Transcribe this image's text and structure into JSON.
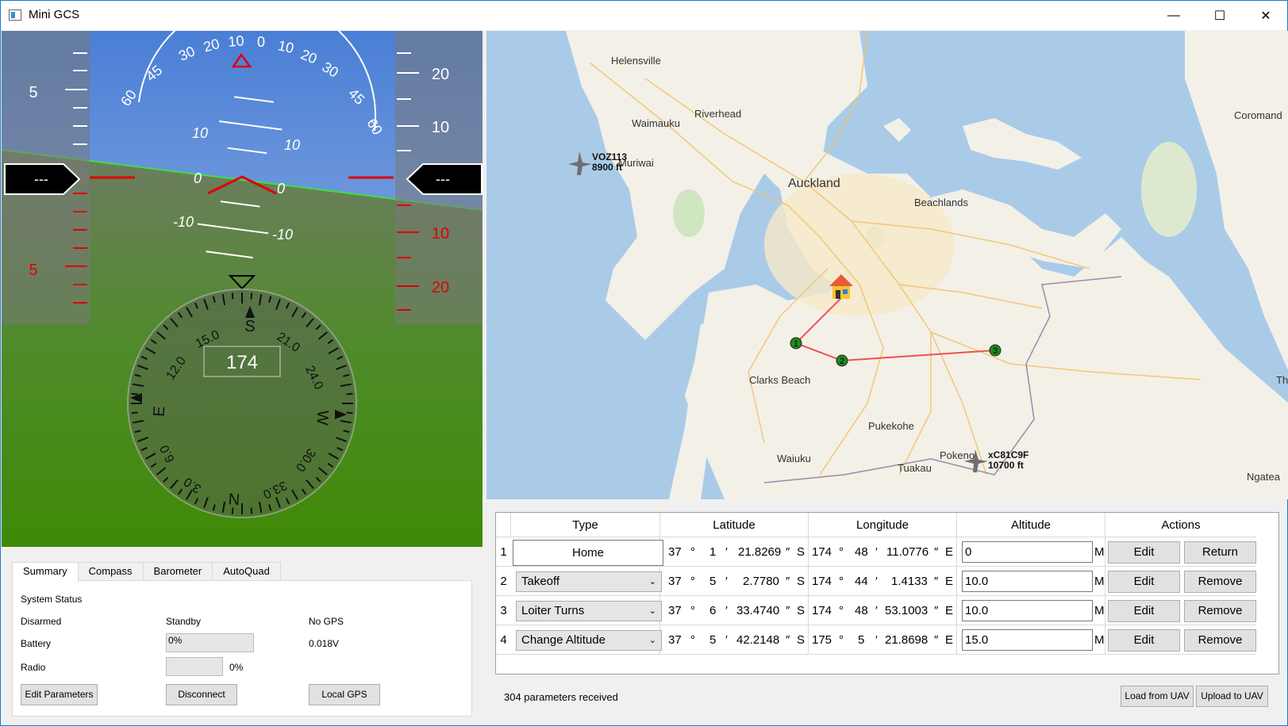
{
  "window": {
    "title": "Mini GCS",
    "controls": {
      "minimize": "—",
      "maximize": "☐",
      "close": "✕"
    }
  },
  "pfd": {
    "roll_scale": [
      "60",
      "45",
      "30",
      "20",
      "10",
      "0",
      "10",
      "20",
      "30",
      "45",
      "60"
    ],
    "pitch_labels": [
      "10",
      "0",
      "-10"
    ],
    "left_tape": {
      "upper": "5",
      "lower": "5",
      "readout": "---"
    },
    "right_tape": {
      "labels": [
        "20",
        "10",
        "10",
        "20"
      ],
      "readout": "---"
    },
    "compass": {
      "heading": "174",
      "labels": [
        "S",
        "21.0",
        "24.0",
        "W",
        "30.0",
        "33.0",
        "N",
        "3.0",
        "6.0",
        "E",
        "12.0",
        "15.0"
      ]
    }
  },
  "tabs": [
    "Summary",
    "Compass",
    "Barometer",
    "AutoQuad"
  ],
  "summary": {
    "system_status_label": "System Status",
    "arm_state": "Disarmed",
    "mode": "Standby",
    "gps": "No GPS",
    "battery_label": "Battery",
    "battery_percent": "0%",
    "battery_voltage": "0.018V",
    "radio_label": "Radio",
    "radio_percent": "0%",
    "buttons": {
      "edit_params": "Edit Parameters",
      "disconnect": "Disconnect",
      "local_gps": "Local GPS"
    }
  },
  "map": {
    "places": {
      "helensville": "Helensville",
      "riverhead": "Riverhead",
      "waimauku": "Waimauku",
      "muriwai": "Muriwai",
      "auckland": "Auckland",
      "beachlands": "Beachlands",
      "clarks_beach": "Clarks Beach",
      "pukekohe": "Pukekohe",
      "waiuku": "Waiuku",
      "tuakau": "Tuakau",
      "pokeno": "Pokeno",
      "coromandel": "Coromand",
      "tha": "Tha",
      "ngatea": "Ngatea"
    },
    "aircraft": [
      {
        "callsign": "VOZ113",
        "altitude": "8900 ft"
      },
      {
        "callsign": "xC81C9F",
        "altitude": "10700 ft"
      }
    ],
    "waypoint_labels": [
      "1",
      "2",
      "3"
    ]
  },
  "mission": {
    "headers": [
      "Type",
      "Latitude",
      "Longitude",
      "Altitude",
      "Actions"
    ],
    "alt_unit": "M",
    "rows": [
      {
        "num": "1",
        "type": "Home",
        "lat_d": "37",
        "lat_m": "1",
        "lat_s": "21.8269",
        "lat_h": "S",
        "lon_d": "174",
        "lon_m": "48",
        "lon_s": "11.0776",
        "lon_h": "E",
        "alt": "0",
        "edit": "Edit",
        "action": "Return"
      },
      {
        "num": "2",
        "type": "Takeoff",
        "lat_d": "37",
        "lat_m": "5",
        "lat_s": "2.7780",
        "lat_h": "S",
        "lon_d": "174",
        "lon_m": "44",
        "lon_s": "1.4133",
        "lon_h": "E",
        "alt": "10.0",
        "edit": "Edit",
        "action": "Remove"
      },
      {
        "num": "3",
        "type": "Loiter Turns",
        "lat_d": "37",
        "lat_m": "6",
        "lat_s": "33.4740",
        "lat_h": "S",
        "lon_d": "174",
        "lon_m": "48",
        "lon_s": "53.1003",
        "lon_h": "E",
        "alt": "10.0",
        "edit": "Edit",
        "action": "Remove"
      },
      {
        "num": "4",
        "type": "Change Altitude",
        "lat_d": "37",
        "lat_m": "5",
        "lat_s": "42.2148",
        "lat_h": "S",
        "lon_d": "175",
        "lon_m": "5",
        "lon_s": "21.8698",
        "lon_h": "E",
        "alt": "15.0",
        "edit": "Edit",
        "action": "Remove"
      }
    ],
    "symbols": {
      "deg": "°",
      "min": "′",
      "sec": "″"
    }
  },
  "status": {
    "message": "304 parameters received",
    "load": "Load from UAV",
    "upload": "Upload to UAV"
  }
}
